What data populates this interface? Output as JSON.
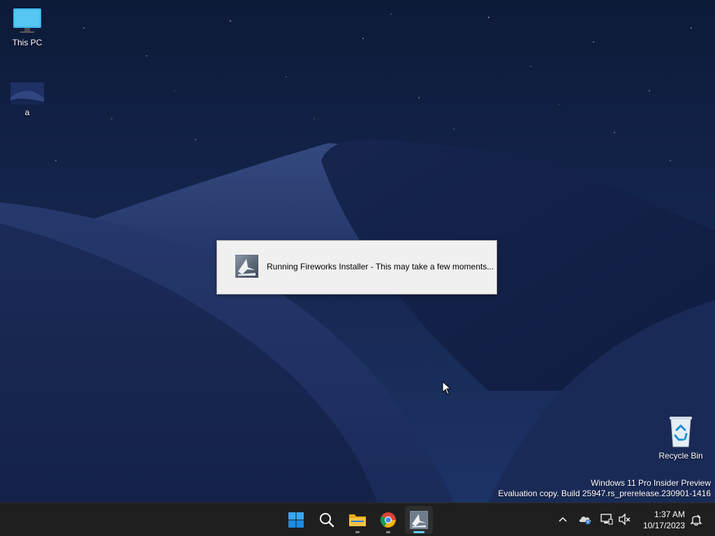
{
  "desktop": {
    "icons": [
      {
        "label": "This PC",
        "icon": "monitor-icon"
      },
      {
        "label": "a",
        "icon": "image-thumbnail-icon"
      },
      {
        "label": "Recycle Bin",
        "icon": "recycle-bin-icon"
      }
    ]
  },
  "dialog": {
    "message": "Running Fireworks Installer - This may take a few moments...",
    "icon": "fireworks-icon"
  },
  "watermark": {
    "line1": "Windows 11 Pro Insider Preview",
    "line2": "Evaluation copy. Build 25947.rs_prerelease.230901-1416"
  },
  "taskbar": {
    "apps": [
      {
        "icon": "windows-start-icon",
        "active": false
      },
      {
        "icon": "search-icon",
        "active": false
      },
      {
        "icon": "file-explorer-icon",
        "active": false,
        "running": true
      },
      {
        "icon": "chrome-icon",
        "active": false,
        "running": true
      },
      {
        "icon": "fireworks-icon",
        "active": true,
        "running": true
      }
    ],
    "tray": {
      "icons": [
        "chevron-up-icon",
        "onedrive-icon",
        "network-icon",
        "volume-muted-icon",
        "notification-icon"
      ],
      "time": "1:37 AM",
      "date": "10/17/2023"
    }
  },
  "colors": {
    "taskbar_bg": "#1f1f1f",
    "accent": "#60cdff",
    "dialog_bg": "#f0f0f0",
    "folder": "#f5c242"
  }
}
